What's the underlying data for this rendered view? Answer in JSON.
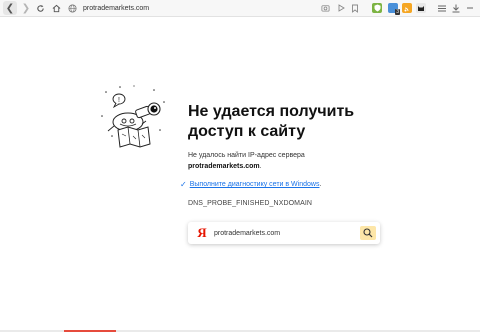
{
  "browser": {
    "url": "protrademarkets.com",
    "badges": {
      "ext_badge": "3"
    }
  },
  "error": {
    "title": "Не удается получить доступ к сайту",
    "desc_line1": "Не удалось найти IP-адрес сервера",
    "domain": "protrademarkets.com",
    "domain_suffix": ".",
    "diagnostics_link": "Выполните диагностику сети в Windows",
    "diagnostics_suffix": ".",
    "code": "DNS_PROBE_FINISHED_NXDOMAIN"
  },
  "search": {
    "logo": "Я",
    "query": "protrademarkets.com"
  },
  "colors": {
    "accent_red": "#e64b3c",
    "link_blue": "#1a73e8",
    "yandex_red": "#e61400"
  }
}
